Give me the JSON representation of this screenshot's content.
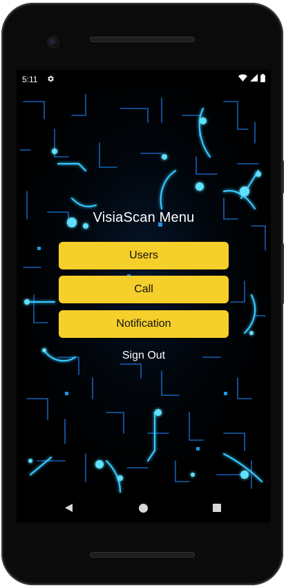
{
  "status_bar": {
    "time": "5:11",
    "settings_icon": "gear-icon",
    "wifi_icon": "wifi-icon",
    "signal_icon": "cell-signal-icon",
    "battery_icon": "battery-icon"
  },
  "screen": {
    "title": "VisiaScan Menu",
    "background": "blue-circuit-glow-art"
  },
  "menu": {
    "users_label": "Users",
    "call_label": "Call",
    "notification_label": "Notification",
    "signout_label": "Sign Out"
  },
  "nav": {
    "back_icon": "back-triangle-icon",
    "home_icon": "home-circle-icon",
    "recents_icon": "recents-square-icon"
  },
  "colors": {
    "button_bg": "#f5cf2a",
    "button_text": "#111111",
    "screen_bg": "#000000",
    "glow": "#33c8ff"
  }
}
